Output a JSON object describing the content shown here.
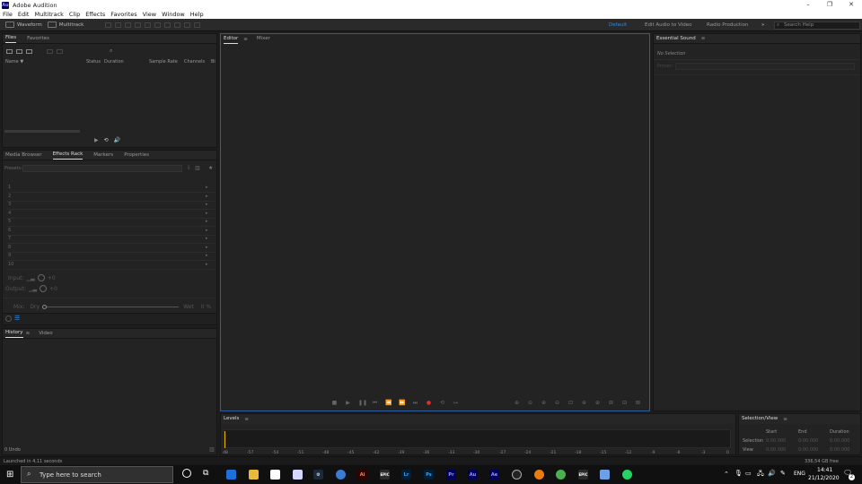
{
  "app": {
    "title": "Adobe Audition",
    "logo_text": "Au"
  },
  "window_controls": [
    "–",
    "❐",
    "✕"
  ],
  "menu": [
    "File",
    "Edit",
    "Multitrack",
    "Clip",
    "Effects",
    "Favorites",
    "View",
    "Window",
    "Help"
  ],
  "toolbar": {
    "waveform": "Waveform",
    "multitrack": "Multitrack"
  },
  "workspaces": {
    "default": "Default",
    "edit_audio_video": "Edit Audio to Video",
    "radio": "Radio Production",
    "more": "»"
  },
  "search": {
    "placeholder": "Search Help"
  },
  "files_panel": {
    "tabs": [
      "Files",
      "Favorites"
    ],
    "columns": [
      "Name ▼",
      "Status",
      "Duration",
      "Sample Rate",
      "Channels",
      "Bi"
    ]
  },
  "effects_panel": {
    "tabs": [
      "Media Browser",
      "Effects Rack",
      "Markers",
      "Properties"
    ],
    "presets_label": "Presets:",
    "rows": [
      "1",
      "2",
      "3",
      "4",
      "5",
      "6",
      "7",
      "8",
      "9",
      "10"
    ],
    "input_label": "Input:",
    "input_db": "+0",
    "output_label": "Output:",
    "output_db": "+0",
    "mix_label": "Mix:",
    "dry_label": "Dry",
    "wet_label": "Wet",
    "wet_pct": "0 %"
  },
  "history_panel": {
    "tabs": [
      "History",
      "Video"
    ],
    "undo": "0 Undo"
  },
  "editor_panel": {
    "tabs": [
      "Editor",
      "Mixer"
    ]
  },
  "essential_sound": {
    "title": "Essential Sound",
    "no_selection": "No Selection",
    "preset_label": "Preset:"
  },
  "levels": {
    "title": "Levels",
    "ticks": [
      "dB",
      "-57",
      "-54",
      "-51",
      "-48",
      "-45",
      "-42",
      "-39",
      "-36",
      "-33",
      "-30",
      "-27",
      "-24",
      "-21",
      "-18",
      "-15",
      "-12",
      "-9",
      "-6",
      "-3",
      "0"
    ]
  },
  "selection_view": {
    "title": "Selection/View",
    "col_start": "Start",
    "col_end": "End",
    "col_duration": "Duration",
    "row_selection": "Selection",
    "row_view": "View",
    "sel_start": "0:00.000",
    "sel_end": "0:00.000",
    "sel_dur": "0:00.000",
    "view_start": "0:00.000",
    "view_end": "0:00.000",
    "view_dur": "0:00.000"
  },
  "status": {
    "left": "Launched in 4,11 seconds",
    "disk": "336,54 GB free"
  },
  "taskbar": {
    "search_placeholder": "Type here to search",
    "icons": [
      {
        "name": "ai",
        "label": "Ai",
        "bg": "#330000",
        "fg": "#ff9a00"
      },
      {
        "name": "epic",
        "label": "EPIC",
        "bg": "#2a2a2a",
        "fg": "#ffffff"
      },
      {
        "name": "lr",
        "label": "Lr",
        "bg": "#001e36",
        "fg": "#31a8ff"
      },
      {
        "name": "ps",
        "label": "Ps",
        "bg": "#001e36",
        "fg": "#31a8ff"
      },
      {
        "name": "pr",
        "label": "Pr",
        "bg": "#00005b",
        "fg": "#9999ff"
      },
      {
        "name": "au",
        "label": "Au",
        "bg": "#00005b",
        "fg": "#9999ff"
      },
      {
        "name": "ae",
        "label": "Ae",
        "bg": "#00005b",
        "fg": "#9999ff"
      }
    ],
    "lang": "ENG",
    "time": "14:41",
    "date": "21/12/2020",
    "notif": "2"
  },
  "colors": {
    "accent": "#2d8ceb",
    "record": "#e03030",
    "playhead": "#e6b800"
  }
}
